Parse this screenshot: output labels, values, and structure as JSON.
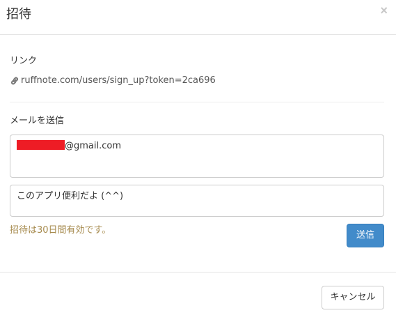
{
  "dialog": {
    "title": "招待",
    "close_label": "×"
  },
  "link_section": {
    "label": "リンク",
    "url": "ruffnote.com/users/sign_up?token=2ca696",
    "icon": "link-icon"
  },
  "email_section": {
    "label": "メールを送信",
    "email_suffix": "@gmail.com",
    "email_redacted": true,
    "message": "このアプリ便利だよ (^^)",
    "validity_note": "招待は30日間有効です。",
    "send_label": "送信"
  },
  "footer": {
    "cancel_label": "キャンセル"
  },
  "colors": {
    "primary": "#428bca",
    "note": "#a68a4d",
    "redaction": "#ee1c25"
  }
}
